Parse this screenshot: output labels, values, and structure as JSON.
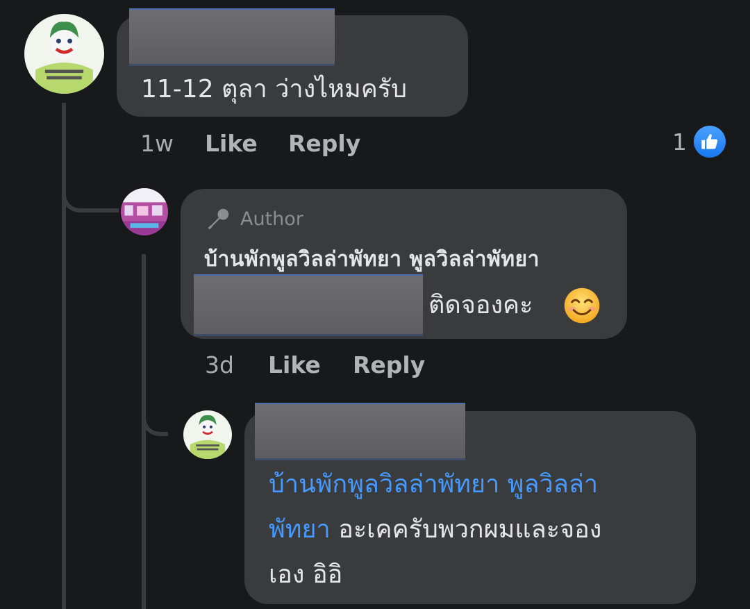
{
  "comments": [
    {
      "text": "11-12 ตุลา ว่างไหมครับ",
      "time": "1w",
      "like_label": "Like",
      "reply_label": "Reply",
      "reaction_count": "1",
      "reaction_icon": "thumbs-up-icon"
    },
    {
      "author_badge": "Author",
      "author_badge_icon": "microphone-icon",
      "page_name": "บ้านพักพูลวิลล่าพัทยา พูลวิลล่าพัทยา",
      "text_suffix": "ติดจองคะ",
      "emoji": "smiling-face-emoji",
      "time": "3d",
      "like_label": "Like",
      "reply_label": "Reply"
    },
    {
      "mention_line1": "บ้านพักพูลวิลล่าพัทยา พูลวิลล่า",
      "mention_line2": "พัทยา",
      "text_line2": " อะเคครับพวกผมและจอง",
      "text_line3": "เอง อิอิ"
    }
  ],
  "colors": {
    "background": "#18191a",
    "bubble": "#3a3b3c",
    "mention": "#4599ff",
    "like_blue": "#1877f2"
  }
}
